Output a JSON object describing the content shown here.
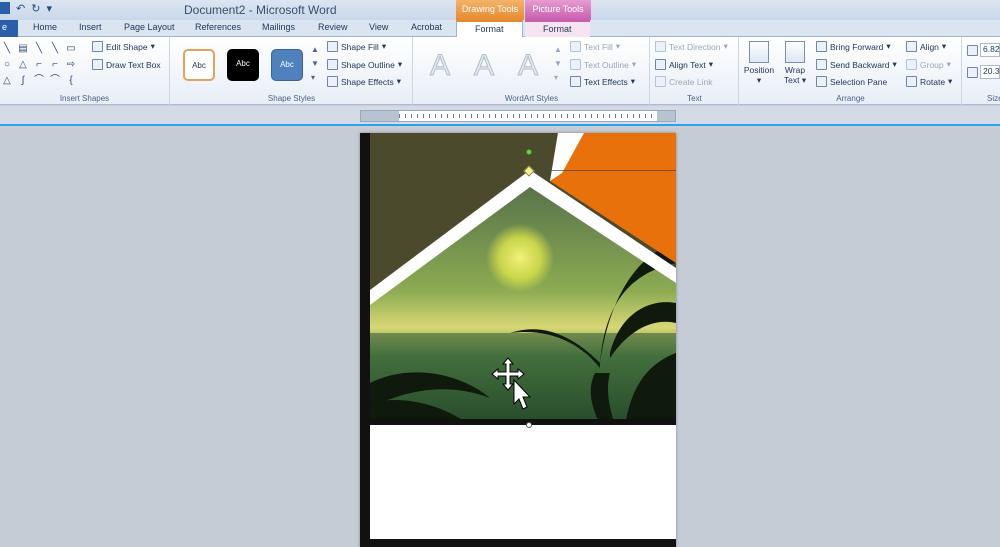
{
  "window": {
    "title": "Document2 - Microsoft Word",
    "context_groups": {
      "drawing": "Drawing Tools",
      "picture": "Picture Tools"
    }
  },
  "tabs": {
    "file": "e",
    "home": "Home",
    "insert": "Insert",
    "page_layout": "Page Layout",
    "references": "References",
    "mailings": "Mailings",
    "review": "Review",
    "view": "View",
    "acrobat": "Acrobat",
    "format_drawing": "Format",
    "format_picture": "Format"
  },
  "ribbon": {
    "insert_shapes": {
      "label": "Insert Shapes",
      "edit_shape": "Edit Shape",
      "draw_text_box": "Draw Text Box"
    },
    "shape_styles": {
      "label": "Shape Styles",
      "swatches": [
        "Abc",
        "Abc",
        "Abc"
      ],
      "shape_fill": "Shape Fill",
      "shape_outline": "Shape Outline",
      "shape_effects": "Shape Effects"
    },
    "wordart": {
      "label": "WordArt Styles",
      "letter": "A",
      "text_fill": "Text Fill",
      "text_outline": "Text Outline",
      "text_effects": "Text Effects"
    },
    "text": {
      "label": "Text",
      "text_direction": "Text Direction",
      "align_text": "Align Text",
      "create_link": "Create Link"
    },
    "arrange": {
      "label": "Arrange",
      "position": "Position",
      "wrap_text": "Wrap Text",
      "bring_forward": "Bring Forward",
      "send_backward": "Send Backward",
      "selection_pane": "Selection Pane",
      "align": "Align",
      "group": "Group",
      "rotate": "Rotate"
    },
    "size": {
      "label": "Size",
      "height": "6.82",
      "width": "20.3"
    }
  },
  "colors": {
    "accent_orange": "#e8710c",
    "selection_blue": "#2fa1e8"
  }
}
